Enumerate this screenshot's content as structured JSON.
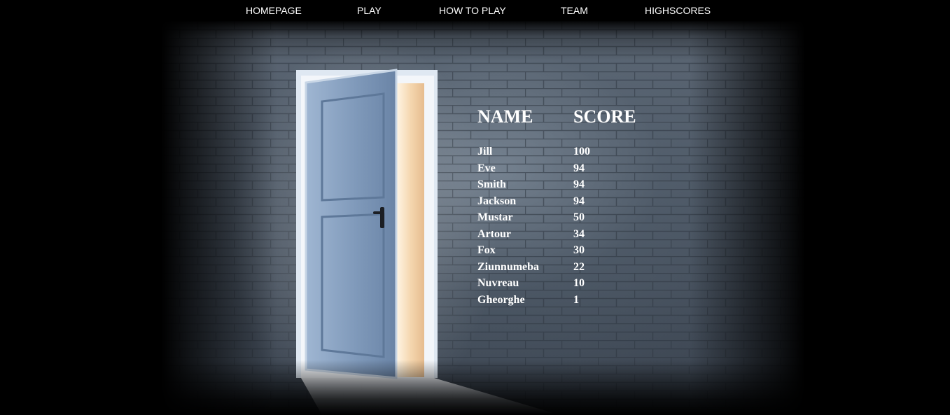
{
  "nav": {
    "items": [
      {
        "label": "HOMEPAGE"
      },
      {
        "label": "PLAY"
      },
      {
        "label": "HOW TO PLAY"
      },
      {
        "label": "TEAM"
      },
      {
        "label": "HIGHSCORES"
      }
    ]
  },
  "highscores": {
    "name_header": "NAME",
    "score_header": "SCORE",
    "rows": [
      {
        "name": "Jill",
        "score": "100"
      },
      {
        "name": "Eve",
        "score": "94"
      },
      {
        "name": "Smith",
        "score": "94"
      },
      {
        "name": "Jackson",
        "score": "94"
      },
      {
        "name": "Mustar",
        "score": "50"
      },
      {
        "name": "Artour",
        "score": "34"
      },
      {
        "name": "Fox",
        "score": "30"
      },
      {
        "name": "Ziunnumeba",
        "score": "22"
      },
      {
        "name": "Nuvreau",
        "score": "10"
      },
      {
        "name": "Gheorghe",
        "score": "1"
      }
    ]
  },
  "colors": {
    "background": "#000000",
    "text": "#ffffff",
    "wall": "#4a5461",
    "door": "#7e9bbd",
    "light": "#f0d2a8"
  }
}
